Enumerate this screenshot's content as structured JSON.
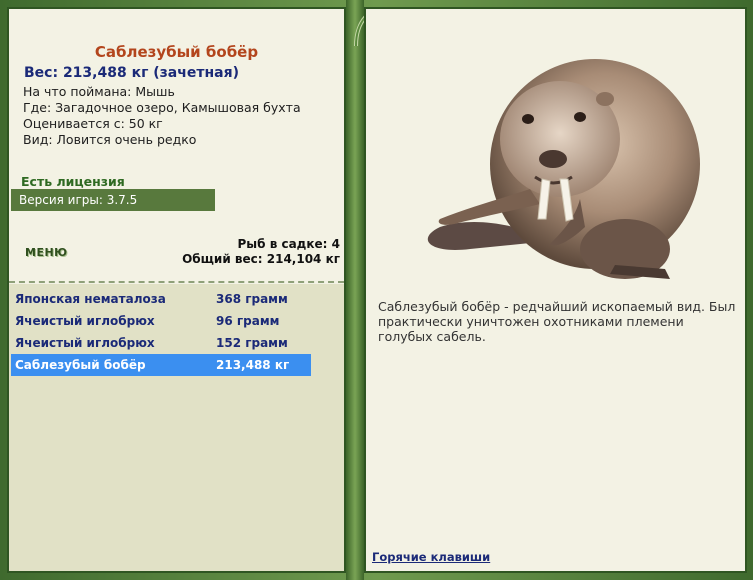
{
  "fish": {
    "title": "Саблезубый бобёр",
    "weight": "Вес: 213,488 кг (зачетная)",
    "caught_on": "На что поймана: Мышь",
    "location": "Где: Загадочное озеро, Камышовая бухта",
    "valued_from": "Оценивается с: 50 кг",
    "rarity": "Вид: Ловится очень редко",
    "description": "Саблезубый бобёр - редчайший ископаемый вид. Был практически уничтожен охотниками племени голубых сабель."
  },
  "license": "Есть лицензия",
  "version": "Версия игры: 3.7.5",
  "menu_label": "МЕНЮ",
  "keepnet": {
    "count": "Рыб в садке: 4",
    "total": "Общий вес: 214,104 кг"
  },
  "catch_list": [
    {
      "name": "Японская нематалоза",
      "weight": "368 грамм",
      "selected": false
    },
    {
      "name": "Ячеистый иглобрюх",
      "weight": "96 грамм",
      "selected": false
    },
    {
      "name": "Ячеистый иглобрюх",
      "weight": "152 грамм",
      "selected": false
    },
    {
      "name": "Саблезубый бобёр",
      "weight": "213,488 кг",
      "selected": true
    }
  ],
  "hotkeys": "Горячие клавиши",
  "colors": {
    "frame": "#4f7a3a",
    "panel": "#f3f2e4",
    "selected": "#3b8ff0",
    "title": "#b3451c",
    "text_blue": "#1b2a78"
  }
}
